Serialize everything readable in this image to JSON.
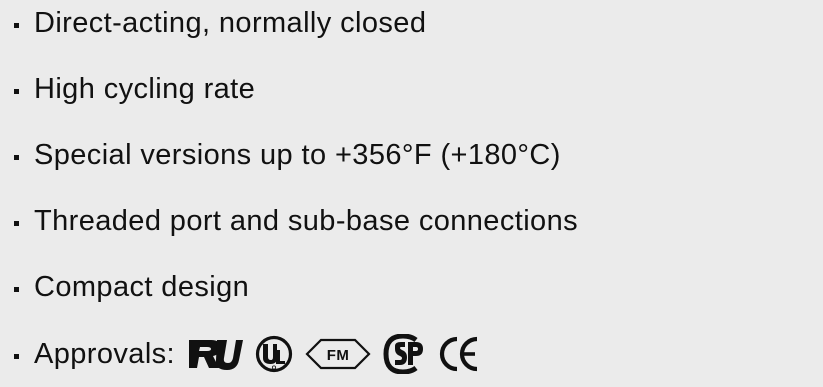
{
  "features": [
    {
      "text": "Direct-acting, normally closed"
    },
    {
      "text": "High cycling rate"
    },
    {
      "text": "Special versions up to +356°F (+180°C)"
    },
    {
      "text": "Threaded port and sub-base connections"
    },
    {
      "text": "Compact design"
    }
  ],
  "approvals": {
    "label": "Approvals:",
    "logos": [
      {
        "icon": "ur-recognized-mark-icon",
        "text": "RU"
      },
      {
        "icon": "ul-listed-mark-icon",
        "text": "UL"
      },
      {
        "icon": "fm-approved-mark-icon",
        "text": "FM"
      },
      {
        "icon": "csa-mark-icon",
        "text": "SP"
      },
      {
        "icon": "ce-mark-icon",
        "text": "CE"
      }
    ]
  },
  "colors": {
    "background": "#ebebeb",
    "text": "#111111"
  }
}
